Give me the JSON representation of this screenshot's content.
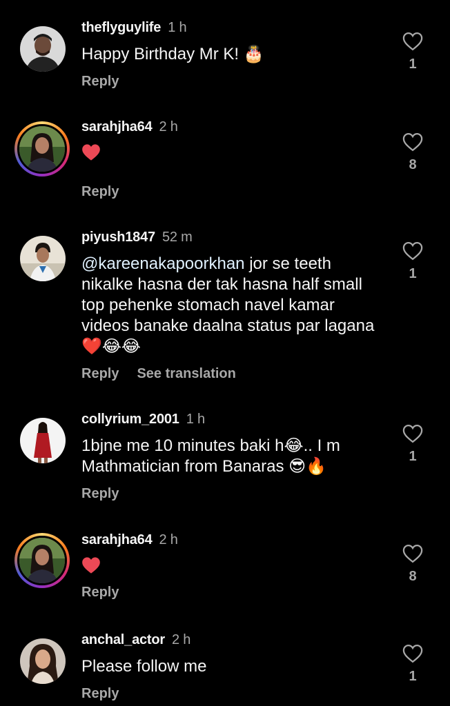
{
  "comments": [
    {
      "username": "theflyguylife",
      "time": "1 h",
      "text_plain": "Happy Birthday Mr K! ",
      "text_emoji": "🎂",
      "reply_label": "Reply",
      "likes": "1",
      "avatar_icon": "man-portrait-avatar",
      "story_ring": false
    },
    {
      "username": "sarahjha64",
      "time": "2 h",
      "text_emoji": "❤️",
      "reply_label": "Reply",
      "likes": "8",
      "avatar_icon": "woman-portrait-avatar",
      "story_ring": true
    },
    {
      "username": "piyush1847",
      "time": "52 m",
      "mention": "@kareenakapoorkhan",
      "text_plain": " jor se teeth nikalke hasna der tak hasna half small top pehenke stomach navel kamar videos banake daalna status par lagana ",
      "text_emoji": "❤️😂😂",
      "reply_label": "Reply",
      "translate_label": "See translation",
      "likes": "1",
      "avatar_icon": "boy-portrait-avatar",
      "story_ring": false
    },
    {
      "username": "collyrium_2001",
      "time": "1 h",
      "text_plain": "1bjne me 10 minutes baki h",
      "text_emoji_1": "😂",
      "text_plain_2": ".. I m Mathmatician from Banaras ",
      "text_emoji_2": "😎🔥",
      "reply_label": "Reply",
      "likes": "1",
      "avatar_icon": "woman-red-dress-avatar",
      "story_ring": false
    },
    {
      "username": "sarahjha64",
      "time": "2 h",
      "text_emoji": "❤️",
      "reply_label": "Reply",
      "likes": "8",
      "avatar_icon": "woman-portrait-avatar",
      "story_ring": true
    },
    {
      "username": "anchal_actor",
      "time": "2 h",
      "text_plain": "Please follow me",
      "reply_label": "Reply",
      "likes": "1",
      "avatar_icon": "woman-portrait-avatar",
      "story_ring": false
    }
  ],
  "icons": {
    "like": "heart-outline-icon"
  },
  "colors": {
    "background": "#000000",
    "secondary_text": "#a8a8a8",
    "heart": "#ed4956"
  }
}
